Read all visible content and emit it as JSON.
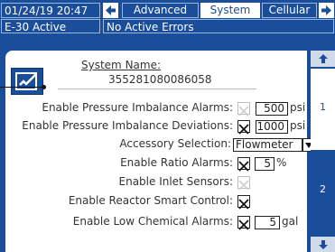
{
  "header": {
    "datetime": "01/24/19 20:47",
    "status": "E-30 Active",
    "errors": "No Active Errors",
    "tabs": [
      {
        "label": "Advanced"
      },
      {
        "label": "System"
      },
      {
        "label": "Cellular"
      }
    ]
  },
  "system_name": {
    "label": "System Name:",
    "value": "355281080086058"
  },
  "settings": {
    "pressure_imbalance_alarms": {
      "label": "Enable Pressure Imbalance Alarms:",
      "value": "500",
      "unit": "psi"
    },
    "pressure_imbalance_deviations": {
      "label": "Enable Pressure Imbalance Deviations:",
      "value": "1000",
      "unit": "psi"
    },
    "accessory_selection": {
      "label": "Accessory Selection:",
      "value": "Flowmeter"
    },
    "ratio_alarms": {
      "label": "Enable Ratio Alarms:",
      "value": "5",
      "unit": "%"
    },
    "inlet_sensors": {
      "label": "Enable Inlet Sensors:"
    },
    "reactor_smart_control": {
      "label": "Enable Reactor Smart Control:"
    },
    "low_chemical_alarms": {
      "label": "Enable Low Chemical Alarms:",
      "value": "5",
      "unit": "gal"
    }
  },
  "pages": {
    "page1": "1",
    "page2": "2"
  },
  "colors": {
    "accent": "#1a4e9a",
    "panel": "#ffffff"
  },
  "icons": {
    "edit": "edit-settings-icon",
    "back": "left-arrow-icon",
    "forward": "right-arrow-icon",
    "scroll_up": "up-arrow-icon",
    "scroll_down": "down-arrow-icon"
  }
}
